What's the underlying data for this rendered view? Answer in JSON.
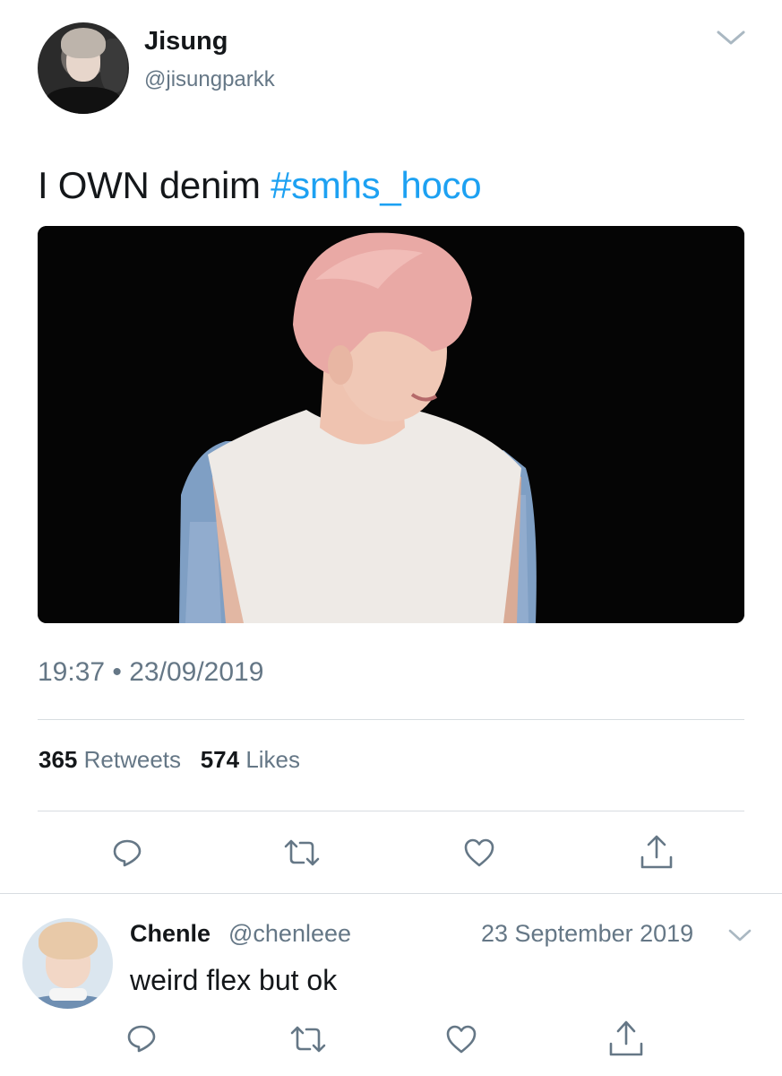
{
  "tweet": {
    "author_name": "Jisung",
    "author_handle": "@jisungparkk",
    "text": "I OWN denim ",
    "hashtag": "#smhs_hoco",
    "time": "19:37 • 23/09/2019",
    "retweets_count": "365",
    "retweets_label": "Retweets",
    "likes_count": "574",
    "likes_label": "Likes"
  },
  "reply": {
    "author_name": "Chenle",
    "author_handle": "@chenleee",
    "date": "23 September 2019",
    "text": "weird flex but ok"
  },
  "icons": {
    "menu": "chevron-down-icon",
    "reply": "speech-bubble-icon",
    "retweet": "retweet-icon",
    "like": "heart-icon",
    "share": "share-icon"
  },
  "colors": {
    "text": "#14171a",
    "secondary": "#657786",
    "link": "#1da1f2",
    "divider": "#d8dde1",
    "icon": "#657786"
  }
}
